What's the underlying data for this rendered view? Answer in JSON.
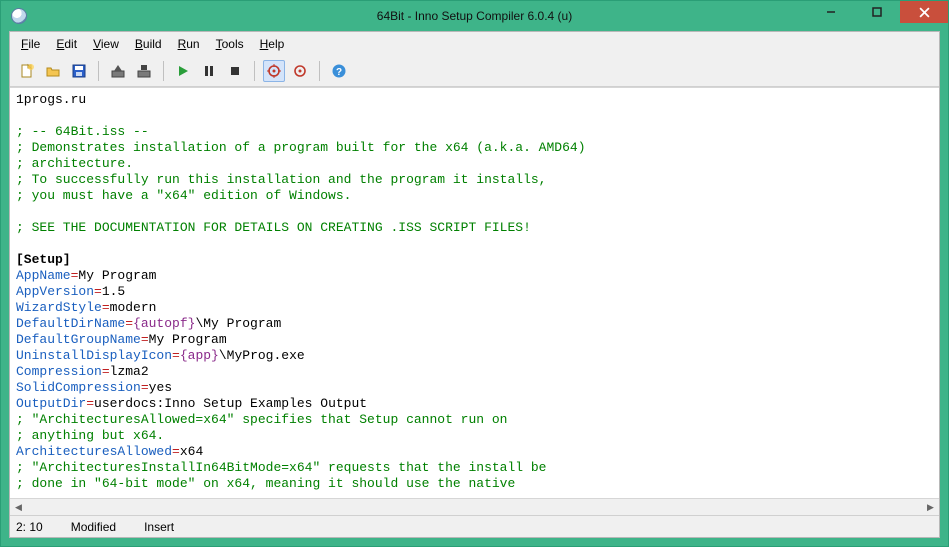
{
  "title": "64Bit - Inno Setup Compiler 6.0.4 (u)",
  "menu": {
    "file": "File",
    "edit": "Edit",
    "view": "View",
    "build": "Build",
    "run": "Run",
    "tools": "Tools",
    "help": "Help"
  },
  "status": {
    "pos": "2:  10",
    "modified": "Modified",
    "mode": "Insert"
  },
  "editor": {
    "line1": "1progs.ru",
    "blank": "",
    "c1": "; -- 64Bit.iss --",
    "c2": "; Demonstrates installation of a program built for the x64 (a.k.a. AMD64)",
    "c3": "; architecture.",
    "c4": "; To successfully run this installation and the program it installs,",
    "c5": "; you must have a \"x64\" edition of Windows.",
    "c6": "; SEE THE DOCUMENTATION FOR DETAILS ON CREATING .ISS SCRIPT FILES!",
    "section_setup": "[Setup]",
    "k_appname": "AppName",
    "v_appname": "My Program",
    "k_appver": "AppVersion",
    "v_appver": "1.5",
    "k_wizard": "WizardStyle",
    "v_wizard": "modern",
    "k_defdir": "DefaultDirName",
    "const_autopf": "{autopf}",
    "v_defdir_tail": "\\My Program",
    "k_defgroup": "DefaultGroupName",
    "v_defgroup": "My Program",
    "k_unicon": "UninstallDisplayIcon",
    "const_app": "{app}",
    "v_unicon_tail": "\\MyProg.exe",
    "k_comp": "Compression",
    "v_comp": "lzma2",
    "k_solid": "SolidCompression",
    "v_solid": "yes",
    "k_outdir": "OutputDir",
    "v_outdir": "userdocs:Inno Setup Examples Output",
    "c7": "; \"ArchitecturesAllowed=x64\" specifies that Setup cannot run on",
    "c8": "; anything but x64.",
    "k_archallow": "ArchitecturesAllowed",
    "v_archallow": "x64",
    "c9": "; \"ArchitecturesInstallIn64BitMode=x64\" requests that the install be",
    "c10": "; done in \"64-bit mode\" on x64, meaning it should use the native",
    "eq": "="
  }
}
